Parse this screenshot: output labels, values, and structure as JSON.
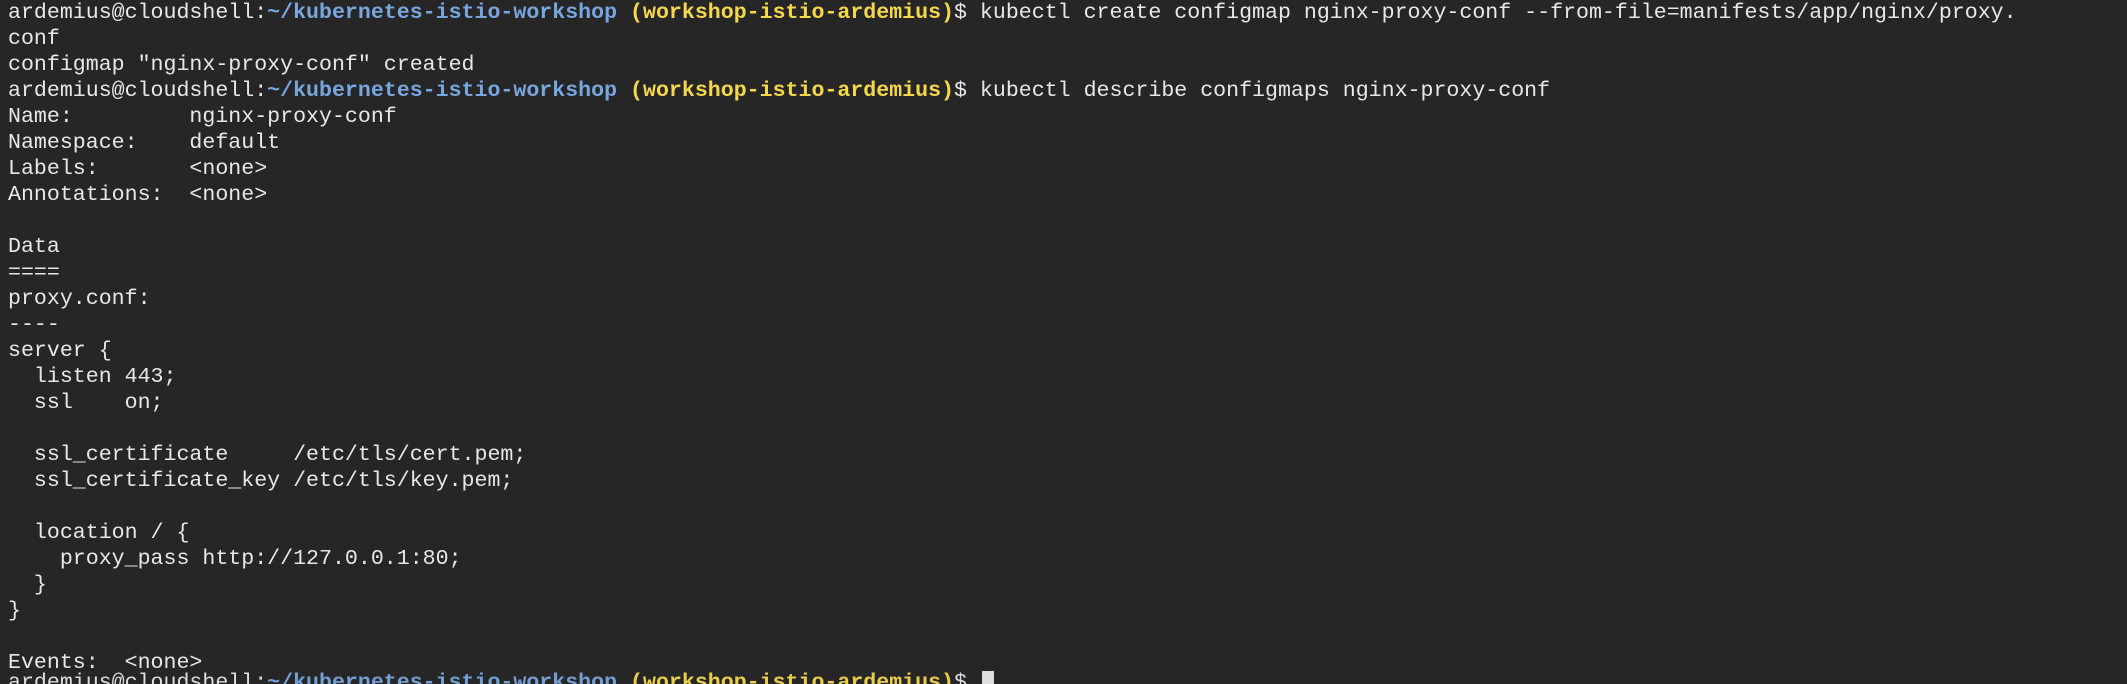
{
  "prompt": {
    "user_host": "ardemius@cloudshell:",
    "path": "~/kubernetes-istio-workshop",
    "project": "(workshop-istio-ardemius)",
    "sign": "$ "
  },
  "commands": {
    "create_part1": "kubectl create configmap nginx-proxy-conf --from-file=manifests/app/nginx/proxy.",
    "create_part2": "conf",
    "describe": "kubectl describe configmaps nginx-proxy-conf"
  },
  "output": {
    "created": "configmap \"nginx-proxy-conf\" created",
    "name": "Name:         nginx-proxy-conf",
    "namespace": "Namespace:    default",
    "labels": "Labels:       <none>",
    "annotations": "Annotations:  <none>",
    "data_header": "Data",
    "data_rule": "====",
    "file_key": "proxy.conf:",
    "file_rule": "----",
    "conf_lines": [
      "server {",
      "  listen 443;",
      "  ssl    on;",
      "",
      "  ssl_certificate     /etc/tls/cert.pem;",
      "  ssl_certificate_key /etc/tls/key.pem;",
      "",
      "  location / {",
      "    proxy_pass http://127.0.0.1:80;",
      "  }",
      "}"
    ],
    "events": "Events:  <none>"
  }
}
